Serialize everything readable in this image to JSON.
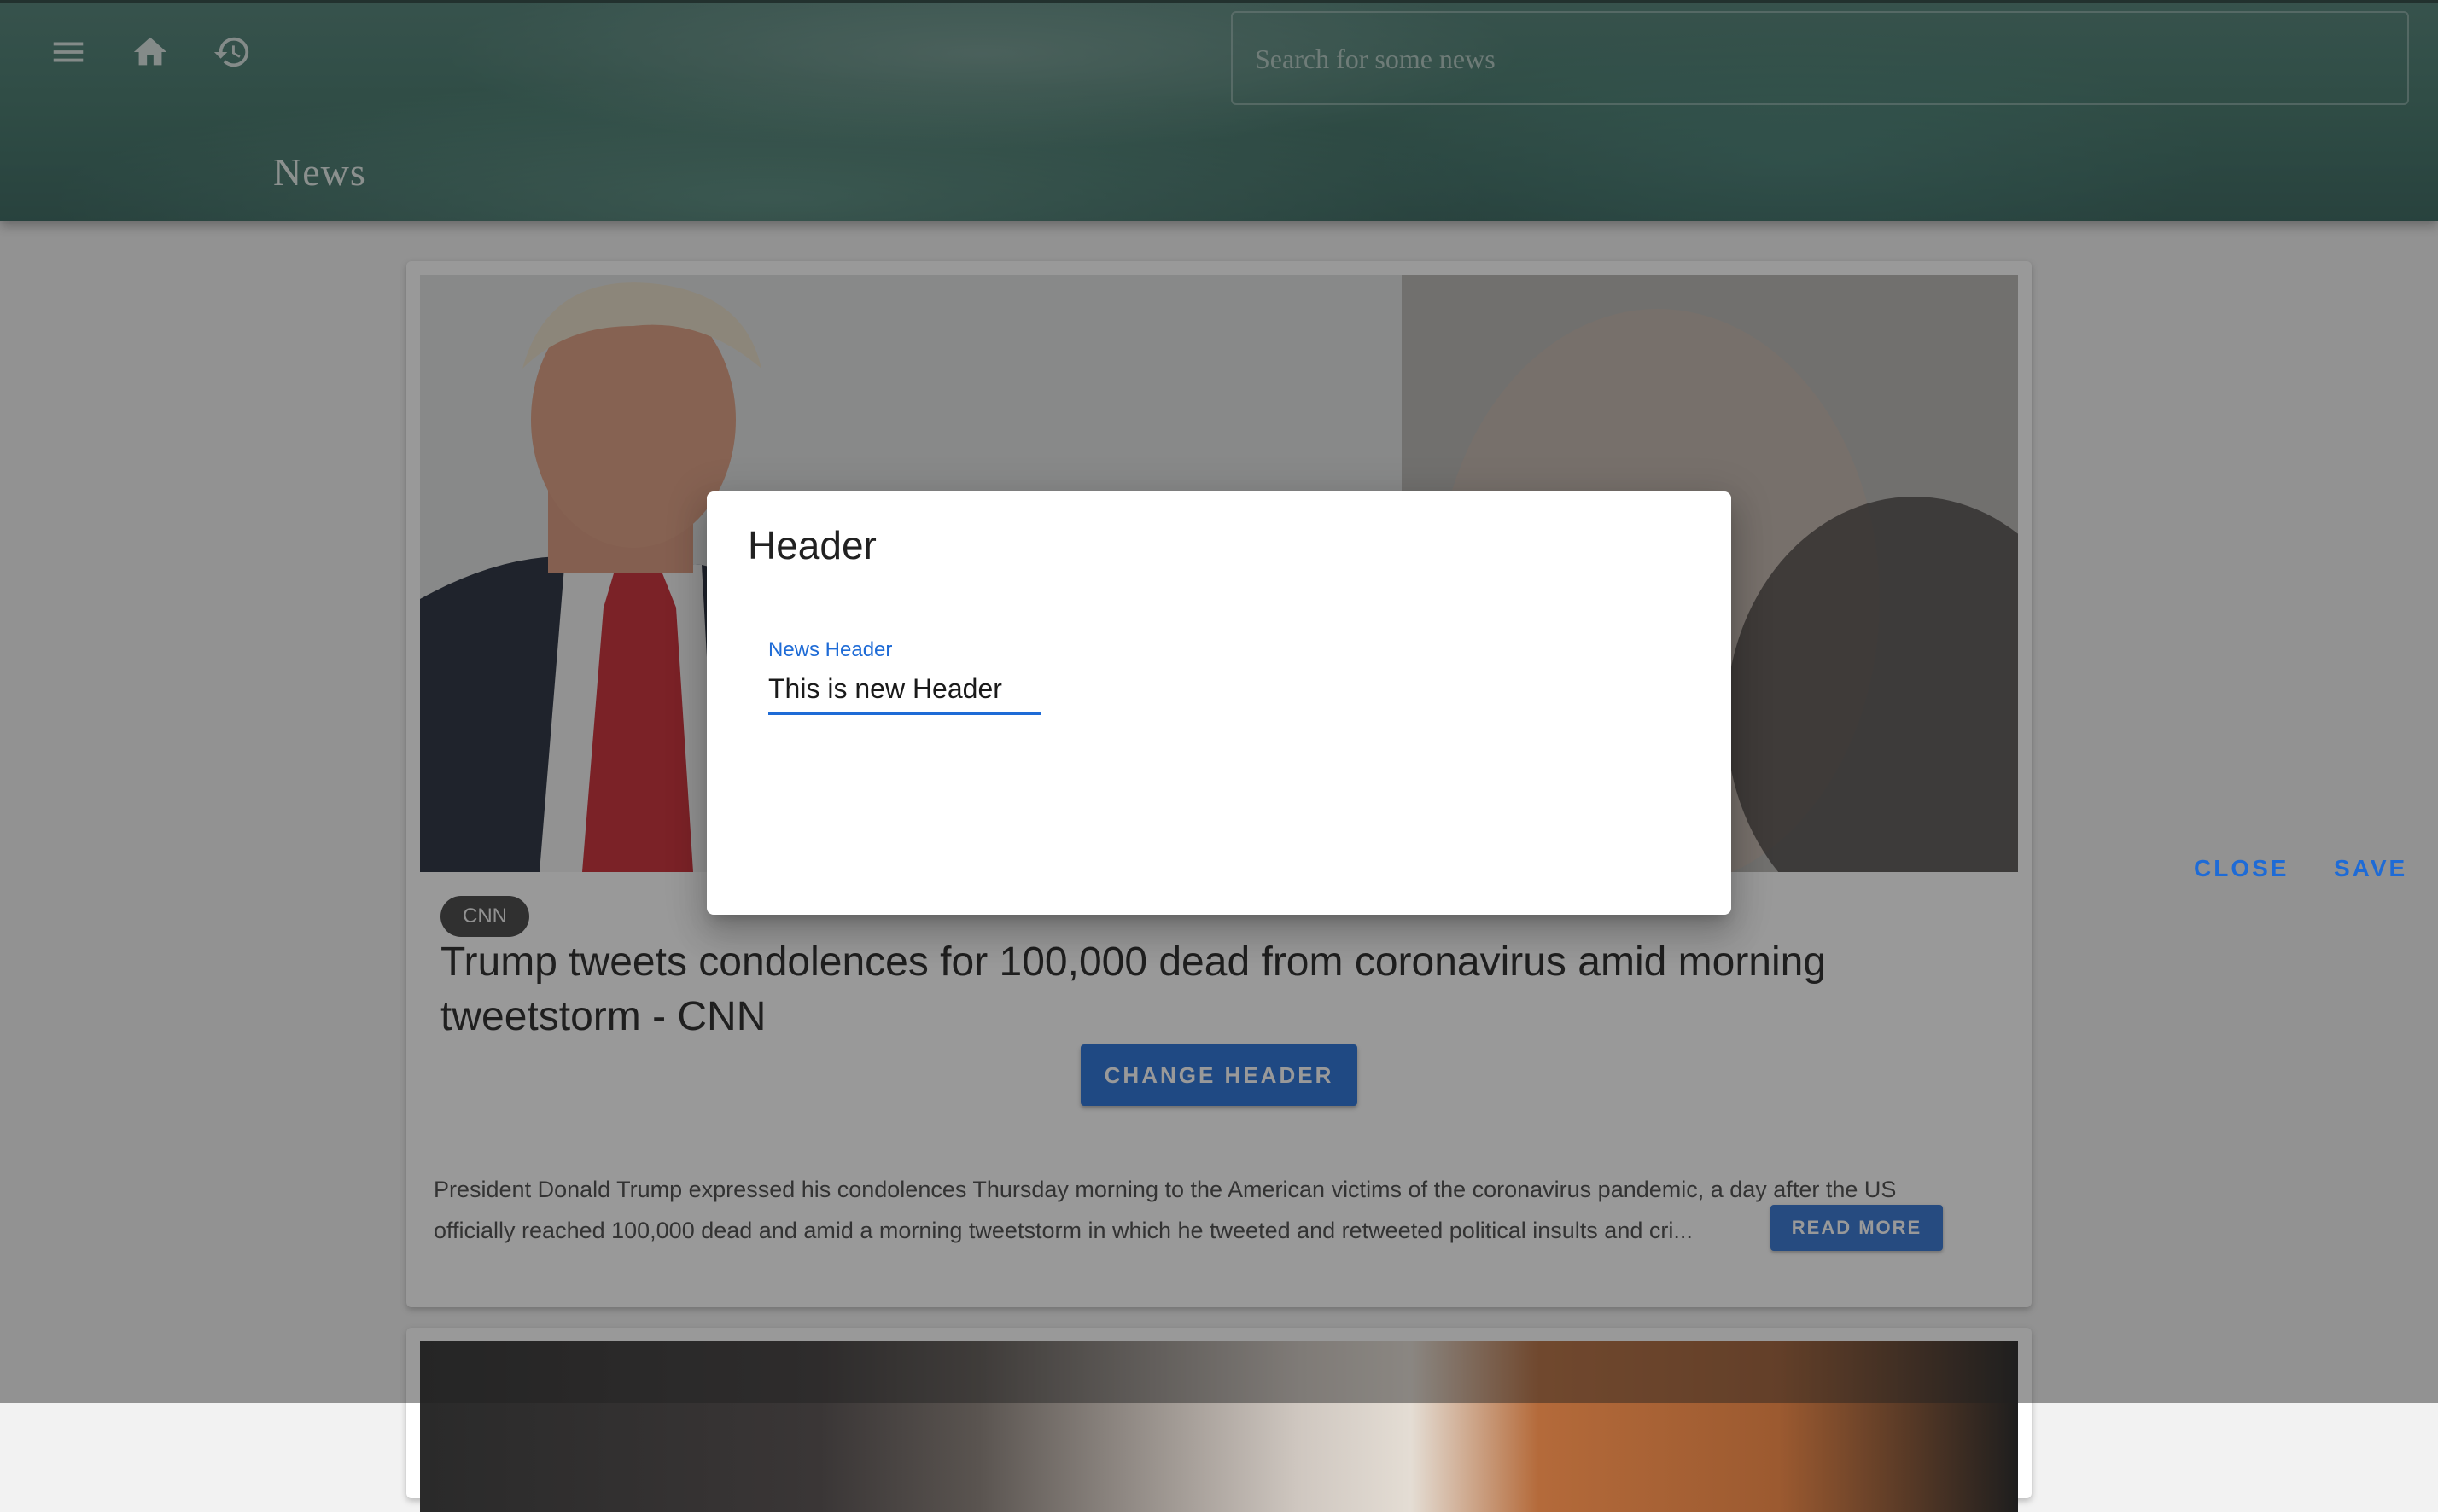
{
  "appbar": {
    "title": "News",
    "search_placeholder": "Search for some news",
    "icons": [
      "menu-icon",
      "home-icon",
      "history-icon"
    ]
  },
  "article": {
    "source": "CNN",
    "title": "Trump tweets condolences for 100,000 dead from coronavirus amid morning tweetstorm - CNN",
    "change_header_label": "CHANGE HEADER",
    "description": "President Donald Trump expressed his condolences Thursday morning to the American victims of the coronavirus pandemic, a day after the US officially reached 100,000 dead and amid a morning tweetstorm in which he tweeted and retweeted political insults and cri...",
    "read_more_label": "READ MORE"
  },
  "dialog": {
    "title": "Header",
    "field_label": "News Header",
    "field_value": "This is new Header",
    "close_label": "CLOSE",
    "save_label": "SAVE"
  },
  "colors": {
    "accent": "#1e6bd6",
    "appbar": "#3d7366",
    "chip": "#3d3d3d"
  }
}
